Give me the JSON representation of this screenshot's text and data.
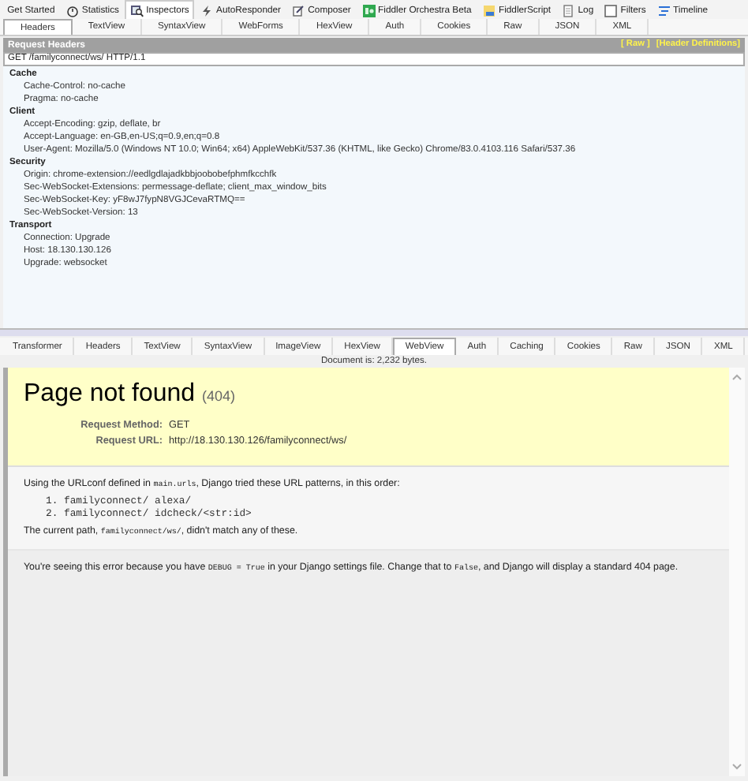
{
  "main_tabs": [
    {
      "label": "Get Started",
      "selected": false
    },
    {
      "label": "Statistics",
      "selected": false
    },
    {
      "label": "Inspectors",
      "selected": true
    },
    {
      "label": "AutoResponder",
      "selected": false
    },
    {
      "label": "Composer",
      "selected": false
    },
    {
      "label": "Fiddler Orchestra Beta",
      "selected": false
    },
    {
      "label": "FiddlerScript",
      "selected": false
    },
    {
      "label": "Log",
      "selected": false
    },
    {
      "label": "Filters",
      "selected": false
    },
    {
      "label": "Timeline",
      "selected": false
    }
  ],
  "request_tabs": [
    {
      "label": "Headers",
      "selected": true
    },
    {
      "label": "TextView",
      "selected": false
    },
    {
      "label": "SyntaxView",
      "selected": false
    },
    {
      "label": "WebForms",
      "selected": false
    },
    {
      "label": "HexView",
      "selected": false
    },
    {
      "label": "Auth",
      "selected": false
    },
    {
      "label": "Cookies",
      "selected": false
    },
    {
      "label": "Raw",
      "selected": false
    },
    {
      "label": "JSON",
      "selected": false
    },
    {
      "label": "XML",
      "selected": false
    }
  ],
  "request_headers": {
    "title": "Request Headers",
    "links": [
      "[ Raw ]",
      "[Header Definitions]"
    ],
    "request_line": "GET /familyconnect/ws/ HTTP/1.1",
    "groups": [
      {
        "name": "Cache",
        "headers": [
          "Cache-Control: no-cache",
          "Pragma: no-cache"
        ]
      },
      {
        "name": "Client",
        "headers": [
          "Accept-Encoding: gzip, deflate, br",
          "Accept-Language: en-GB,en-US;q=0.9,en;q=0.8",
          "User-Agent: Mozilla/5.0 (Windows NT 10.0; Win64; x64) AppleWebKit/537.36 (KHTML, like Gecko) Chrome/83.0.4103.116 Safari/537.36"
        ]
      },
      {
        "name": "Security",
        "headers": [
          "Origin: chrome-extension://eedlgdlajadkbbjoobobefphmfkcchfk",
          "Sec-WebSocket-Extensions: permessage-deflate; client_max_window_bits",
          "Sec-WebSocket-Key: yF8wJ7fypN8VGJCevaRTMQ==",
          "Sec-WebSocket-Version: 13"
        ]
      },
      {
        "name": "Transport",
        "headers": [
          "Connection: Upgrade",
          "Host: 18.130.130.126",
          "Upgrade: websocket"
        ]
      }
    ]
  },
  "response_tabs": [
    {
      "label": "Transformer",
      "selected": false
    },
    {
      "label": "Headers",
      "selected": false
    },
    {
      "label": "TextView",
      "selected": false
    },
    {
      "label": "SyntaxView",
      "selected": false
    },
    {
      "label": "ImageView",
      "selected": false
    },
    {
      "label": "HexView",
      "selected": false
    },
    {
      "label": "WebView",
      "selected": true
    },
    {
      "label": "Auth",
      "selected": false
    },
    {
      "label": "Caching",
      "selected": false
    },
    {
      "label": "Cookies",
      "selected": false
    },
    {
      "label": "Raw",
      "selected": false
    },
    {
      "label": "JSON",
      "selected": false
    },
    {
      "label": "XML",
      "selected": false
    }
  ],
  "document_info": "Document is: 2,232 bytes.",
  "web_page": {
    "title": "Page not found",
    "code": "(404)",
    "meta": [
      {
        "label": "Request Method:",
        "value": "GET"
      },
      {
        "label": "Request URL:",
        "value": "http://18.130.130.126/familyconnect/ws/"
      }
    ],
    "intro": [
      {
        "kind": "text",
        "text": "Using the URLconf defined in "
      },
      {
        "kind": "code",
        "text": "main.urls"
      },
      {
        "kind": "text",
        "text": ", Django tried these URL patterns, in this order:"
      }
    ],
    "patterns": [
      "1. familyconnect/ alexa/",
      "2. familyconnect/ idcheck/<str:id>"
    ],
    "current_path": [
      {
        "kind": "text",
        "text": "The current path, "
      },
      {
        "kind": "code",
        "text": "familyconnect/ws/"
      },
      {
        "kind": "text",
        "text": ", didn't match any of these."
      }
    ],
    "explanation": [
      {
        "kind": "text",
        "text": "You're seeing this error because you have "
      },
      {
        "kind": "code",
        "text": "DEBUG = True"
      },
      {
        "kind": "text",
        "text": " in your Django settings file. Change that to "
      },
      {
        "kind": "code",
        "text": "False"
      },
      {
        "kind": "text",
        "text": ", and Django will display a standard 404 page."
      }
    ]
  }
}
